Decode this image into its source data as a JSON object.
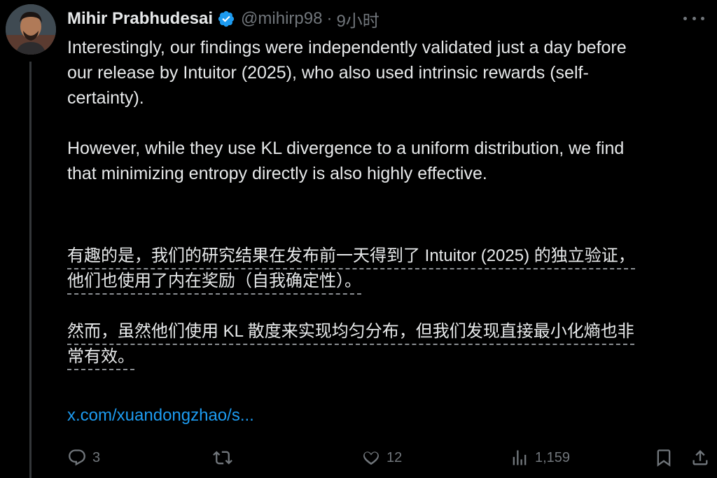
{
  "author": {
    "name": "Mihir Prabhudesai",
    "handle": "@mihirp98",
    "separator": "·",
    "time": "9小时"
  },
  "tweet": {
    "en_para1": "Interestingly, our findings were independently validated just a day before our release by Intuitor (2025), who also used intrinsic rewards (self-certainty).",
    "en_para1_line1": "Interestingly, our findings were independently validated just a day before",
    "en_para1_line2": "our release by Intuitor (2025), who also used intrinsic rewards (self-",
    "en_para1_line3": "certainty).",
    "en_para2_line1": "However, while they use KL divergence to a uniform distribution, we find",
    "en_para2_line2": "that minimizing entropy directly is also highly effective.",
    "zh_para1_line1": "有趣的是，我们的研究结果在发布前一天得到了 Intuitor (2025) 的独立验证，",
    "zh_para1_line2": "他们也使用了内在奖励（自我确定性）。",
    "zh_para2_line1": "然而，虽然他们使用 KL 散度来实现均匀分布，但我们发现直接最小化熵也非",
    "zh_para2_line2": "常有效。",
    "link": "x.com/xuandongzhao/s..."
  },
  "actions": {
    "replies": "3",
    "likes": "12",
    "views": "1,159"
  },
  "colors": {
    "background": "#000000",
    "text": "#e7e9ea",
    "muted": "#71767b",
    "link": "#1d9bf0",
    "verified": "#1d9bf0"
  },
  "icons": [
    "more-icon",
    "verified-badge-icon",
    "reply-icon",
    "retweet-icon",
    "like-icon",
    "views-icon",
    "bookmark-icon",
    "share-icon"
  ]
}
